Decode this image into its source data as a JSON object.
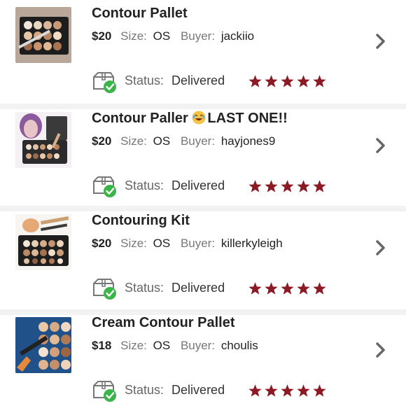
{
  "colors": {
    "star": "#8b1a24",
    "check": "#3bb54a",
    "chevron": "#666666"
  },
  "items": [
    {
      "title": "Contour Pallet",
      "emoji": "",
      "title_suffix": "",
      "price": "$20",
      "size_label": "Size:",
      "size": "OS",
      "buyer_label": "Buyer:",
      "buyer": "jackiio",
      "status_label": "Status:",
      "status": "Delivered",
      "rating": 5
    },
    {
      "title": "Contour Paller ",
      "emoji": "laughing-face-icon",
      "title_suffix": "LAST ONE!!",
      "price": "$20",
      "size_label": "Size:",
      "size": "OS",
      "buyer_label": "Buyer:",
      "buyer": "hayjones9",
      "status_label": "Status:",
      "status": "Delivered",
      "rating": 5
    },
    {
      "title": "Contouring Kit",
      "emoji": "",
      "title_suffix": "",
      "price": "$20",
      "size_label": "Size:",
      "size": "OS",
      "buyer_label": "Buyer:",
      "buyer": "killerkyleigh",
      "status_label": "Status:",
      "status": "Delivered",
      "rating": 5
    },
    {
      "title": "Cream Contour Pallet",
      "emoji": "",
      "title_suffix": "",
      "price": "$18",
      "size_label": "Size:",
      "size": "OS",
      "buyer_label": "Buyer:",
      "buyer": "choulis",
      "status_label": "Status:",
      "status": "Delivered",
      "rating": 5
    }
  ]
}
